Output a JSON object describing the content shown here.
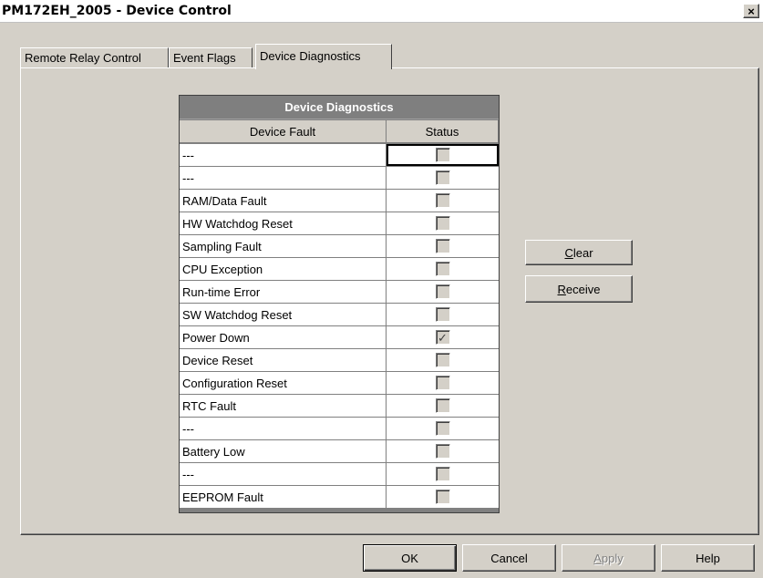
{
  "window": {
    "title": "PM172EH_2005 - Device Control",
    "close_label": "×"
  },
  "tabs": [
    {
      "label": "Remote Relay Control"
    },
    {
      "label": "Event Flags"
    },
    {
      "label": "Device Diagnostics",
      "active": true
    }
  ],
  "grid": {
    "title": "Device Diagnostics",
    "col_fault": "Device Fault",
    "col_status": "Status",
    "rows": [
      {
        "fault": "---",
        "checked": false
      },
      {
        "fault": "---",
        "checked": false
      },
      {
        "fault": "RAM/Data Fault",
        "checked": false
      },
      {
        "fault": "HW Watchdog Reset",
        "checked": false
      },
      {
        "fault": "Sampling Fault",
        "checked": false
      },
      {
        "fault": "CPU Exception",
        "checked": false
      },
      {
        "fault": "Run-time Error",
        "checked": false
      },
      {
        "fault": "SW Watchdog Reset",
        "checked": false
      },
      {
        "fault": "Power Down",
        "checked": true
      },
      {
        "fault": "Device Reset",
        "checked": false
      },
      {
        "fault": "Configuration Reset",
        "checked": false
      },
      {
        "fault": "RTC Fault",
        "checked": false
      },
      {
        "fault": "---",
        "checked": false
      },
      {
        "fault": "Battery Low",
        "checked": false
      },
      {
        "fault": "---",
        "checked": false
      },
      {
        "fault": "EEPROM Fault",
        "checked": false
      }
    ],
    "check_glyph": "✓"
  },
  "side_buttons": {
    "clear": {
      "mnemonic": "C",
      "rest": "lear"
    },
    "receive": {
      "mnemonic": "R",
      "rest": "eceive"
    }
  },
  "dialog_buttons": {
    "ok": "OK",
    "cancel": "Cancel",
    "apply": {
      "mnemonic": "A",
      "rest": "pply",
      "disabled": true
    },
    "help": "Help"
  }
}
